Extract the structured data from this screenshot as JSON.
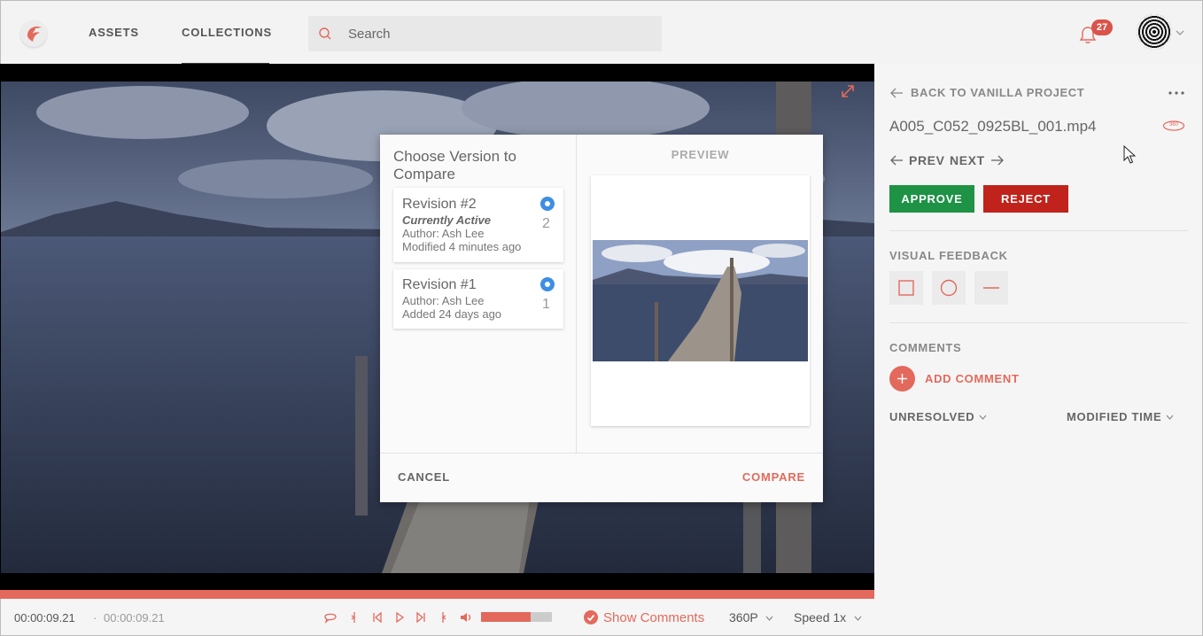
{
  "header": {
    "nav": [
      {
        "label": "ASSETS"
      },
      {
        "label": "COLLECTIONS"
      }
    ],
    "search": {
      "placeholder": "Search",
      "value": ""
    },
    "notifications": {
      "count": "27"
    }
  },
  "player": {
    "time_current": "00:00:09.21",
    "time_separator": "·",
    "time_total": "00:00:09.21",
    "volume_percent": 70,
    "show_comments_label": "Show Comments",
    "quality_label": "360P",
    "speed_label": "Speed 1x",
    "accent_color": "#e3695c"
  },
  "sidebar": {
    "back_label": "BACK TO VANILLA PROJECT",
    "file_name": "A005_C052_0925BL_001.mp4",
    "vr_badge": "360",
    "prev_label": "PREV",
    "next_label": "NEXT",
    "approve_label": "APPROVE",
    "reject_label": "REJECT",
    "visual_feedback_label": "VISUAL FEEDBACK",
    "comments_label": "COMMENTS",
    "add_comment_label": "ADD COMMENT",
    "filter_status": "UNRESOLVED",
    "filter_sort": "MODIFIED TIME",
    "approve_color": "#1e9245",
    "reject_color": "#c0231b"
  },
  "modal": {
    "title": "Choose Version to Compare",
    "preview_label": "PREVIEW",
    "revisions": [
      {
        "title": "Revision #2",
        "status": "Currently Active",
        "author": "Author: Ash Lee",
        "date": "Modified 4 minutes ago",
        "number": "2",
        "selected": true
      },
      {
        "title": "Revision #1",
        "author": "Author: Ash Lee",
        "date": "Added 24 days ago",
        "number": "1",
        "selected": true
      }
    ],
    "cancel_label": "CANCEL",
    "compare_label": "COMPARE"
  }
}
